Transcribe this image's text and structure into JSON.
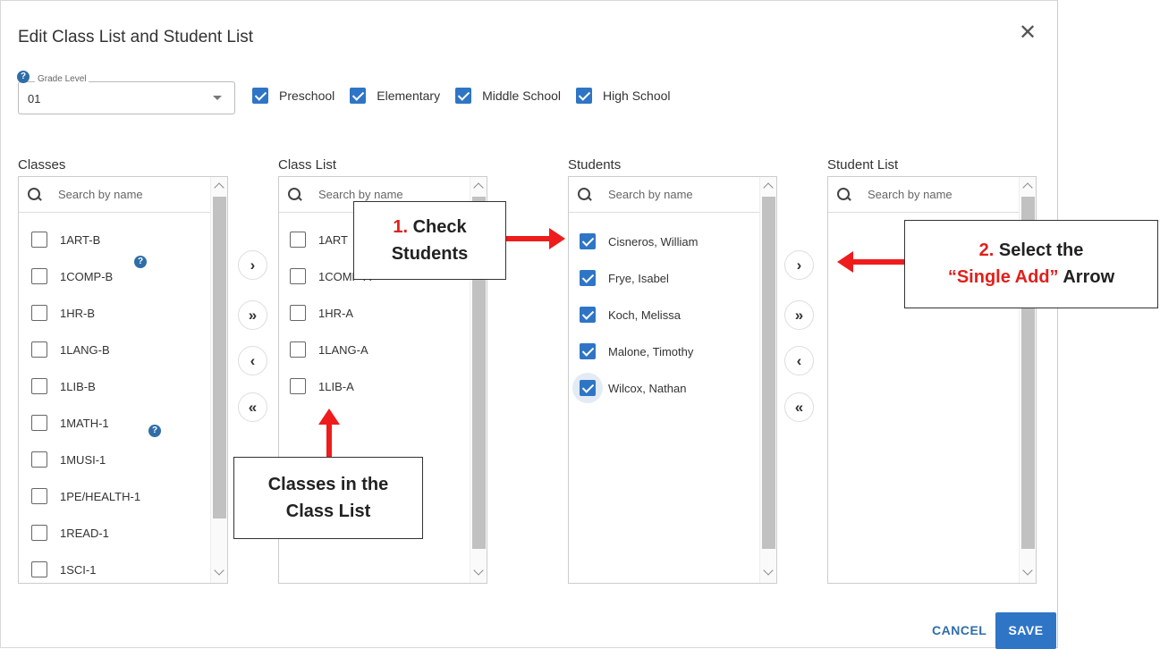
{
  "dialog": {
    "title": "Edit Class List and Student List",
    "close_glyph": "✕",
    "cancel_label": "CANCEL",
    "save_label": "SAVE"
  },
  "grade_level": {
    "label": "Grade Level",
    "value": "01",
    "help_icon": "?"
  },
  "filters": [
    {
      "label": "Preschool",
      "checked": true
    },
    {
      "label": "Elementary",
      "checked": true
    },
    {
      "label": "Middle School",
      "checked": true
    },
    {
      "label": "High School",
      "checked": true
    }
  ],
  "columns": {
    "classes": {
      "heading": "Classes",
      "search_placeholder": "Search by name",
      "items": [
        {
          "label": "1ART-B",
          "checked": false
        },
        {
          "label": "1COMP-B",
          "checked": false
        },
        {
          "label": "1HR-B",
          "checked": false
        },
        {
          "label": "1LANG-B",
          "checked": false
        },
        {
          "label": "1LIB-B",
          "checked": false
        },
        {
          "label": "1MATH-1",
          "checked": false
        },
        {
          "label": "1MUSI-1",
          "checked": false
        },
        {
          "label": "1PE/HEALTH-1",
          "checked": false
        },
        {
          "label": "1READ-1",
          "checked": false
        },
        {
          "label": "1SCI-1",
          "checked": false
        }
      ]
    },
    "class_list": {
      "heading": "Class List",
      "search_placeholder": "Search by name",
      "items": [
        {
          "label": "1ART",
          "checked": false
        },
        {
          "label": "1COMP-A",
          "checked": false
        },
        {
          "label": "1HR-A",
          "checked": false
        },
        {
          "label": "1LANG-A",
          "checked": false
        },
        {
          "label": "1LIB-A",
          "checked": false
        }
      ]
    },
    "students": {
      "heading": "Students",
      "search_placeholder": "Search by name",
      "items": [
        {
          "label": "Cisneros, William",
          "checked": true
        },
        {
          "label": "Frye, Isabel",
          "checked": true
        },
        {
          "label": "Koch, Melissa",
          "checked": true
        },
        {
          "label": "Malone, Timothy",
          "checked": true
        },
        {
          "label": "Wilcox, Nathan",
          "checked": true
        }
      ]
    },
    "student_list": {
      "heading": "Student List",
      "search_placeholder": "Search by name",
      "items": []
    }
  },
  "transfer_buttons": {
    "add_one": "›",
    "add_all": "»",
    "remove_one": "‹",
    "remove_all": "«"
  },
  "help_glyph": "?",
  "annotations": {
    "check_students": {
      "number": "1.",
      "line1": "Check",
      "line2": "Students"
    },
    "single_add": {
      "number": "2.",
      "line1": "Select the",
      "line2_red": "“Single Add”",
      "line2_black": "Arrow"
    },
    "class_list_note": {
      "line1": "Classes in the",
      "line2": "Class List"
    }
  },
  "colors": {
    "accent": "#2f75c6",
    "annotation_red": "#ee1c1c"
  }
}
